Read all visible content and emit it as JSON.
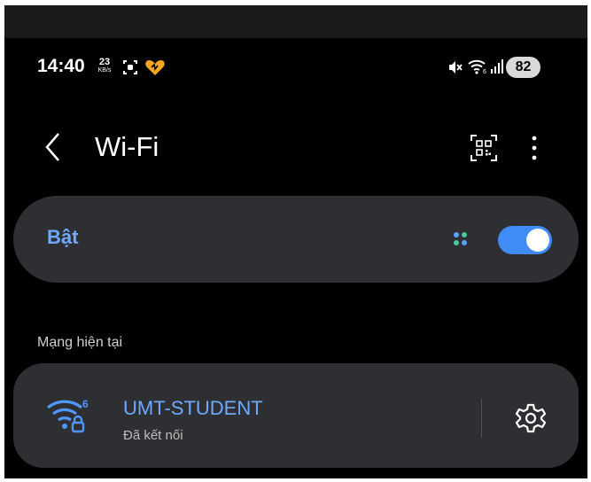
{
  "status_bar": {
    "time": "14:40",
    "net_speed_value": "23",
    "net_speed_unit": "KB/s",
    "battery": "82",
    "icons": [
      "screen-record-icon",
      "heart-icon",
      "mute-icon",
      "wifi-icon",
      "signal-icon"
    ]
  },
  "app_bar": {
    "title": "Wi-Fi",
    "icons": [
      "back-icon",
      "qr-scan-icon",
      "more-vert-icon"
    ]
  },
  "wifi_toggle": {
    "label": "Bật",
    "state_on": true
  },
  "current_network": {
    "header": "Mạng hiện tại",
    "name": "UMT-STUDENT",
    "status": "Đã kết nối",
    "icons": [
      "wifi-lock-icon",
      "gear-icon"
    ]
  },
  "colors": {
    "background": "#000000",
    "card": "#2e2f33",
    "accent": "#3f8cf7",
    "accent_text": "#6ea9ff",
    "heart": "#f5a623"
  }
}
